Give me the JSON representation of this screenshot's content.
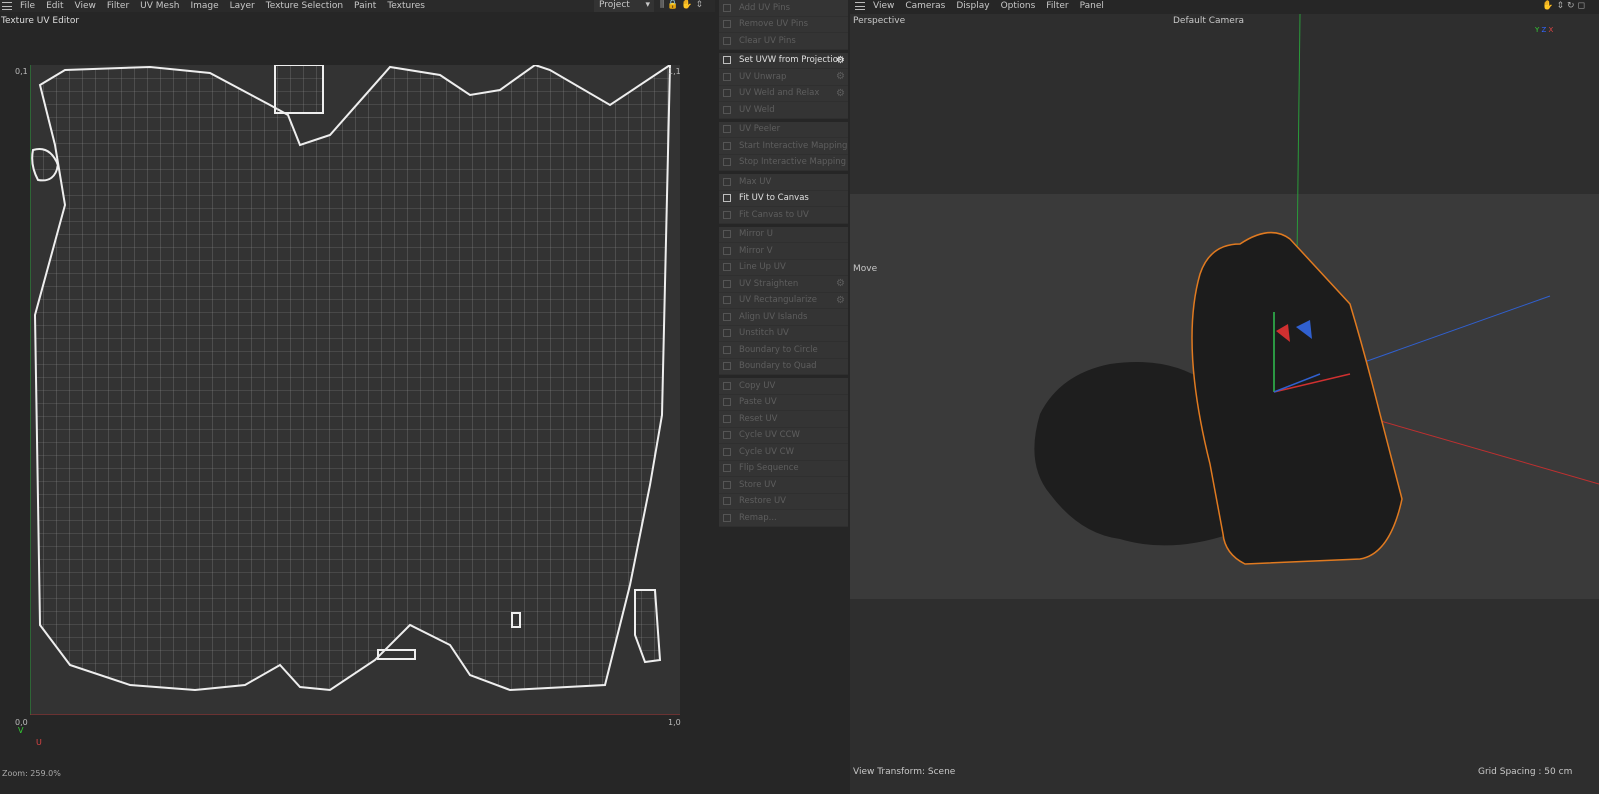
{
  "uv_menu": [
    "File",
    "Edit",
    "View",
    "Filter",
    "UV Mesh",
    "Image",
    "Layer",
    "Texture Selection",
    "Paint",
    "Textures"
  ],
  "project_select": "Project",
  "uv_title": "Texture UV Editor",
  "axis": {
    "top_left": "0,1",
    "top_right": "1,1",
    "bottom_left": "0,0",
    "bottom_right": "1,0",
    "u": "U",
    "v": "V"
  },
  "zoom": "Zoom: 259.0%",
  "tools": [
    [
      {
        "label": "Add UV Pins",
        "on": false
      },
      {
        "label": "Remove UV Pins",
        "on": false
      },
      {
        "label": "Clear UV Pins",
        "on": false
      }
    ],
    [
      {
        "label": "Set UVW from Projection",
        "on": true,
        "gear": true
      },
      {
        "label": "UV Unwrap",
        "on": false,
        "gear": true
      },
      {
        "label": "UV Weld and Relax",
        "on": false,
        "gear": true
      },
      {
        "label": "UV Weld",
        "on": false
      }
    ],
    [
      {
        "label": "UV Peeler",
        "on": false
      },
      {
        "label": "Start Interactive Mapping",
        "on": false
      },
      {
        "label": "Stop Interactive Mapping",
        "on": false
      }
    ],
    [
      {
        "label": "Max UV",
        "on": false
      },
      {
        "label": "Fit UV to Canvas",
        "on": true
      },
      {
        "label": "Fit Canvas to UV",
        "on": false
      }
    ],
    [
      {
        "label": "Mirror U",
        "on": false
      },
      {
        "label": "Mirror V",
        "on": false
      },
      {
        "label": "Line Up UV",
        "on": false
      },
      {
        "label": "UV Straighten",
        "on": false,
        "gear": true
      },
      {
        "label": "UV Rectangularize",
        "on": false,
        "gear": true
      },
      {
        "label": "Align UV Islands",
        "on": false
      },
      {
        "label": "Unstitch UV",
        "on": false
      },
      {
        "label": "Boundary to Circle",
        "on": false
      },
      {
        "label": "Boundary to Quad",
        "on": false
      }
    ],
    [
      {
        "label": "Copy UV",
        "on": false
      },
      {
        "label": "Paste UV",
        "on": false
      },
      {
        "label": "Reset UV",
        "on": false
      },
      {
        "label": "Cycle UV CCW",
        "on": false
      },
      {
        "label": "Cycle UV CW",
        "on": false
      },
      {
        "label": "Flip Sequence",
        "on": false
      },
      {
        "label": "Store UV",
        "on": false
      },
      {
        "label": "Restore UV",
        "on": false
      },
      {
        "label": "Remap...",
        "on": false
      }
    ]
  ],
  "vp_menu": [
    "View",
    "Cameras",
    "Display",
    "Options",
    "Filter",
    "Panel"
  ],
  "vp": {
    "perspective": "Perspective",
    "camera": "Default Camera",
    "move": "Move",
    "view_transform": "View Transform: Scene",
    "grid_spacing": "Grid Spacing : 50 cm"
  },
  "colors": {
    "selection": "#e07a20",
    "x_axis": "#d03030",
    "y_axis": "#30c050",
    "z_axis": "#3060d0"
  }
}
